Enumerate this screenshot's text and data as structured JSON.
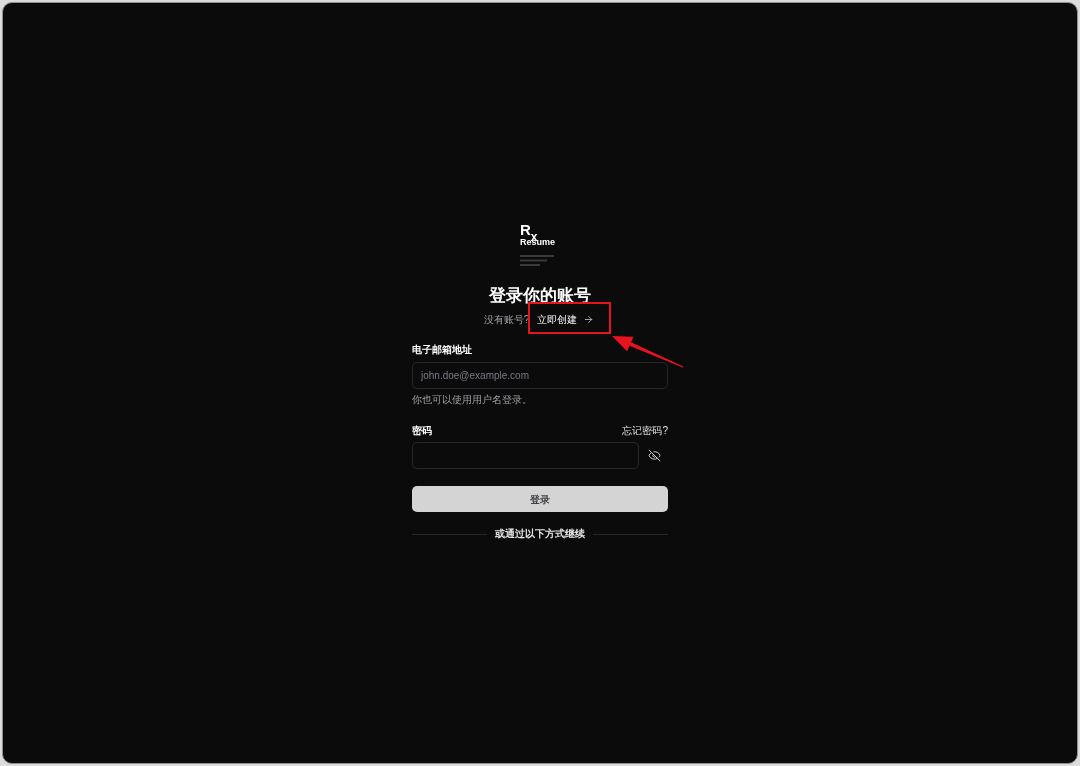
{
  "logo": {
    "mark": "R$_{x}$",
    "name": "Resume"
  },
  "heading": "登录你的账号",
  "signup": {
    "prompt": "没有账号?",
    "link": "立即创建"
  },
  "email": {
    "label": "电子邮箱地址",
    "placeholder": "john.doe@example.com",
    "hint": "你也可以使用用户名登录。"
  },
  "password": {
    "label": "密码",
    "forgot_link": "忘记密码?"
  },
  "submit_button": "登录",
  "divider_text": "或通过以下方式继续"
}
